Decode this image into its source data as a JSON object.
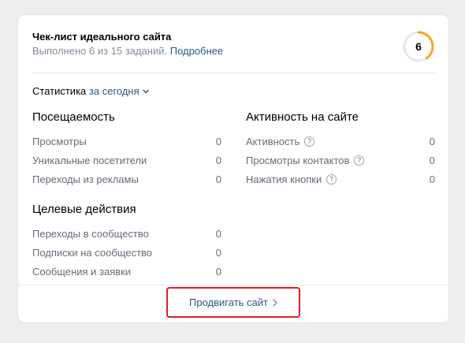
{
  "checklist": {
    "title": "Чек-лист идеального сайта",
    "progress_text": "Выполнено 6 из 15 заданий.",
    "more_link": "Подробнее",
    "completed": 6,
    "total": 15,
    "ring_color": "#f5a623"
  },
  "stats": {
    "label": "Статистика",
    "period": "за сегодня"
  },
  "traffic": {
    "title": "Посещаемость",
    "items": [
      {
        "label": "Просмотры",
        "value": "0"
      },
      {
        "label": "Уникальные посетители",
        "value": "0"
      },
      {
        "label": "Переходы из рекламы",
        "value": "0"
      }
    ]
  },
  "activity": {
    "title": "Активность на сайте",
    "items": [
      {
        "label": "Активность",
        "value": "0"
      },
      {
        "label": "Просмотры контактов",
        "value": "0"
      },
      {
        "label": "Нажатия кнопки",
        "value": "0"
      }
    ]
  },
  "goals": {
    "title": "Целевые действия",
    "items": [
      {
        "label": "Переходы в сообщество",
        "value": "0"
      },
      {
        "label": "Подписки на сообщество",
        "value": "0"
      },
      {
        "label": "Сообщения и заявки",
        "value": "0"
      }
    ]
  },
  "footer": {
    "promote_label": "Продвигать сайт"
  },
  "colors": {
    "link": "#2a5885",
    "muted": "#818c99",
    "highlight_border": "#e01f26"
  }
}
